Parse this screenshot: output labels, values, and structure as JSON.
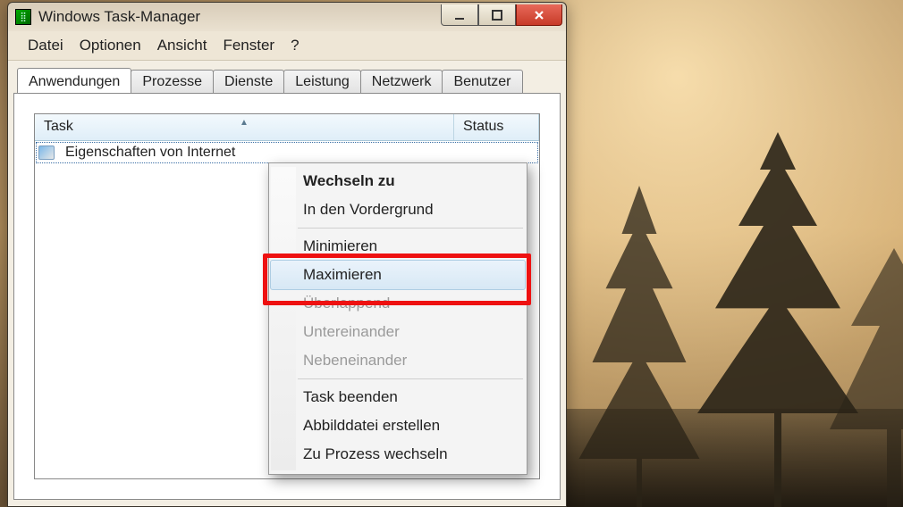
{
  "window": {
    "title": "Windows Task-Manager",
    "menus": [
      "Datei",
      "Optionen",
      "Ansicht",
      "Fenster",
      "?"
    ]
  },
  "tabs": [
    "Anwendungen",
    "Prozesse",
    "Dienste",
    "Leistung",
    "Netzwerk",
    "Benutzer"
  ],
  "active_tab": "Anwendungen",
  "columns": {
    "task": "Task",
    "status": "Status"
  },
  "rows": [
    {
      "label": "Eigenschaften von Internet",
      "status": ""
    }
  ],
  "context_menu": {
    "items": [
      {
        "label": "Wechseln zu",
        "bold": true
      },
      {
        "label": "In den Vordergrund"
      },
      {
        "sep": true
      },
      {
        "label": "Minimieren"
      },
      {
        "label": "Maximieren",
        "hover": true
      },
      {
        "label": "Überlappend",
        "disabled": true
      },
      {
        "label": "Untereinander",
        "disabled": true
      },
      {
        "label": "Nebeneinander",
        "disabled": true
      },
      {
        "sep": true
      },
      {
        "label": "Task beenden"
      },
      {
        "label": "Abbilddatei erstellen"
      },
      {
        "label": "Zu Prozess wechseln"
      }
    ]
  }
}
